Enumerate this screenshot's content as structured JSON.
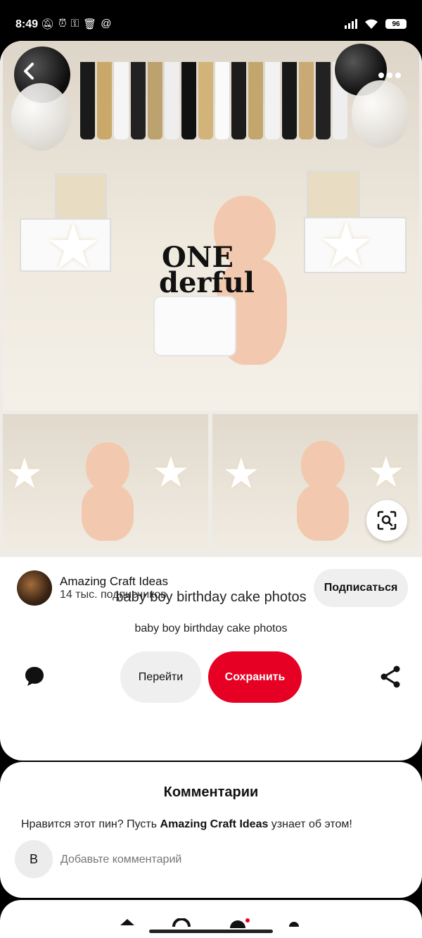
{
  "status_bar": {
    "time": "8:49",
    "battery": "96"
  },
  "pin": {
    "title": "baby boy birthday cake photos",
    "description": "baby boy birthday cake photos",
    "image_cake_text": "ONE derful"
  },
  "creator": {
    "name": "Amazing Craft Ideas",
    "subscribers": "14 тыс. подписчиков",
    "follow_label": "Подписаться"
  },
  "actions": {
    "go_label": "Перейти",
    "save_label": "Сохранить"
  },
  "comments": {
    "title": "Комментарии",
    "prompt_before": "Нравится этот пин? Пусть ",
    "prompt_name": "Amazing Craft Ideas",
    "prompt_after": " узнает об этом!",
    "avatar_letter": "B",
    "input_placeholder": "Добавьте комментарий"
  },
  "colors": {
    "save_button": "#e60023",
    "secondary_button": "#efefef",
    "notification_dot": "#e60023"
  },
  "icons": [
    "back-icon",
    "more-icon",
    "visual-search-icon",
    "comment-icon",
    "share-icon",
    "home-icon",
    "search-icon",
    "messages-icon",
    "profile-icon"
  ]
}
